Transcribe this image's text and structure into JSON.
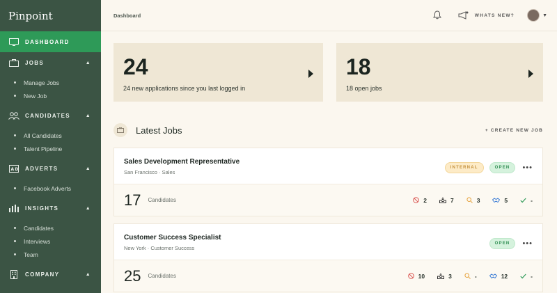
{
  "sidebar": {
    "brand": "Pinpoint",
    "sections": [
      {
        "label": "Dashboard",
        "icon": "monitor-icon",
        "active": true,
        "items": []
      },
      {
        "label": "Jobs",
        "icon": "briefcase-icon",
        "items": [
          "Manage Jobs",
          "New Job"
        ]
      },
      {
        "label": "Candidates",
        "icon": "people-icon",
        "items": [
          "All Candidates",
          "Talent Pipeline"
        ]
      },
      {
        "label": "Adverts",
        "icon": "ad-icon",
        "items": [
          "Facebook Adverts"
        ]
      },
      {
        "label": "Insights",
        "icon": "bar-chart-icon",
        "items": [
          "Candidates",
          "Interviews",
          "Team"
        ]
      },
      {
        "label": "Company",
        "icon": "building-icon",
        "items": []
      }
    ]
  },
  "topbar": {
    "breadcrumb": "Dashboard",
    "whats_new": "WHATS NEW?"
  },
  "stats": [
    {
      "value": "24",
      "label": "24 new applications since you last logged in"
    },
    {
      "value": "18",
      "label": "18 open jobs"
    }
  ],
  "latest": {
    "title": "Latest Jobs",
    "create_label": "+ CREATE NEW JOB"
  },
  "jobs": [
    {
      "title": "Sales Development Representative",
      "subtitle": "San Francisco · Sales",
      "badges": [
        "INTERNAL",
        "OPEN"
      ],
      "candidates": "17",
      "candidates_label": "Candidates",
      "stages": {
        "rejected": "2",
        "inbox": "7",
        "review": "3",
        "interview": "5",
        "hired": "-"
      }
    },
    {
      "title": "Customer Success Specialist",
      "subtitle": "New York · Customer Success",
      "badges": [
        "OPEN"
      ],
      "candidates": "25",
      "candidates_label": "Candidates",
      "stages": {
        "rejected": "10",
        "inbox": "3",
        "review": "-",
        "interview": "12",
        "hired": "-"
      }
    }
  ],
  "colors": {
    "sidebar": "#3b5444",
    "active": "#2e9a58",
    "rejected": "#d9534f",
    "review": "#e6a23c",
    "interview": "#3a7bd5",
    "hired": "#2e9a58"
  }
}
